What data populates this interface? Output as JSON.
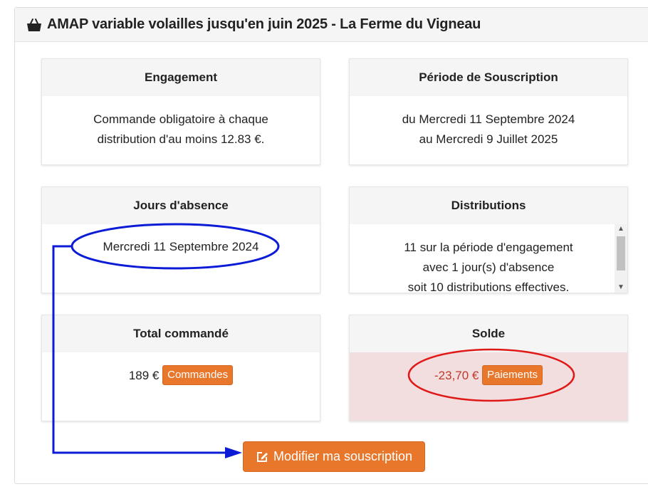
{
  "panel": {
    "title": "AMAP variable volailles jusqu'en juin 2025 - La Ferme du Vigneau",
    "icon": "basket-icon"
  },
  "engagement": {
    "heading": "Engagement",
    "line1": "Commande obligatoire à chaque",
    "line2": "distribution d'au moins 12.83 €."
  },
  "periode": {
    "heading": "Période de Souscription",
    "line1": "du Mercredi 11 Septembre 2024",
    "line2": "au Mercredi 9 Juillet 2025"
  },
  "absence": {
    "heading": "Jours d'absence",
    "day": "Mercredi 11 Septembre 2024"
  },
  "distributions": {
    "heading": "Distributions",
    "line1": "11 sur la période d'engagement",
    "line2": "avec 1 jour(s) d'absence",
    "line3": "soit 10 distributions effectives."
  },
  "total": {
    "heading": "Total commandé",
    "amount": "189 €",
    "button": "Commandes"
  },
  "solde": {
    "heading": "Solde",
    "amount": "-23,70 €",
    "button": "Paiements"
  },
  "modify_button": {
    "label": "Modifier ma souscription",
    "icon": "edit-icon"
  },
  "colors": {
    "accent": "#e8762b",
    "solde_bg": "#f2dede",
    "annotation_blue": "#0b1bd6",
    "annotation_red": "#e01818"
  }
}
